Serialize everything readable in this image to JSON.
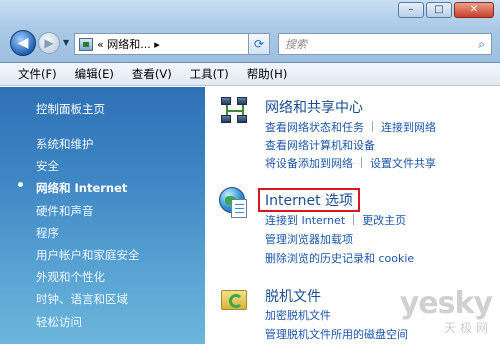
{
  "window": {
    "controls": {
      "minimize": "–",
      "maximize": "□",
      "close": "✕"
    }
  },
  "toolbar": {
    "back_icon": "◀",
    "forward_icon": "▶",
    "address_path": "« 网络和... ▸",
    "address_drop": "▼",
    "refresh_icon": "⟳",
    "search_placeholder": "搜索",
    "search_icon": "⌕"
  },
  "menubar": {
    "items": [
      "文件(F)",
      "编辑(E)",
      "查看(V)",
      "工具(T)",
      "帮助(H)"
    ]
  },
  "sidebar": {
    "title": "控制面板主页",
    "items": [
      "系统和维护",
      "安全",
      "网络和 Internet",
      "硬件和声音",
      "程序",
      "用户帐户和家庭安全",
      "外观和个性化",
      "时钟、语言和区域",
      "轻松访问"
    ],
    "active_index": 2
  },
  "content": {
    "categories": [
      {
        "title": "网络和共享中心",
        "icon": "network-icon",
        "links": [
          [
            "查看网络状态和任务",
            "连接到网络"
          ],
          [
            "查看网络计算机和设备"
          ],
          [
            "将设备添加到网络",
            "设置文件共享"
          ]
        ]
      },
      {
        "title": "Internet 选项",
        "icon": "internet-options-icon",
        "highlighted": true,
        "links": [
          [
            "连接到 Internet",
            "更改主页"
          ],
          [
            "管理浏览器加载项"
          ],
          [
            "删除浏览的历史记录和 cookie"
          ]
        ]
      },
      {
        "title": "脱机文件",
        "icon": "offline-files-icon",
        "links": [
          [
            "加密脱机文件"
          ],
          [
            "管理脱机文件所用的磁盘空间"
          ]
        ]
      }
    ]
  },
  "watermark": {
    "main": "yesky",
    "sub": "天极网"
  },
  "colors": {
    "link": "#1c56a8",
    "title": "#1a4d8f",
    "highlight_box": "#e0141c",
    "sidebar_top": "#2e71b5"
  }
}
